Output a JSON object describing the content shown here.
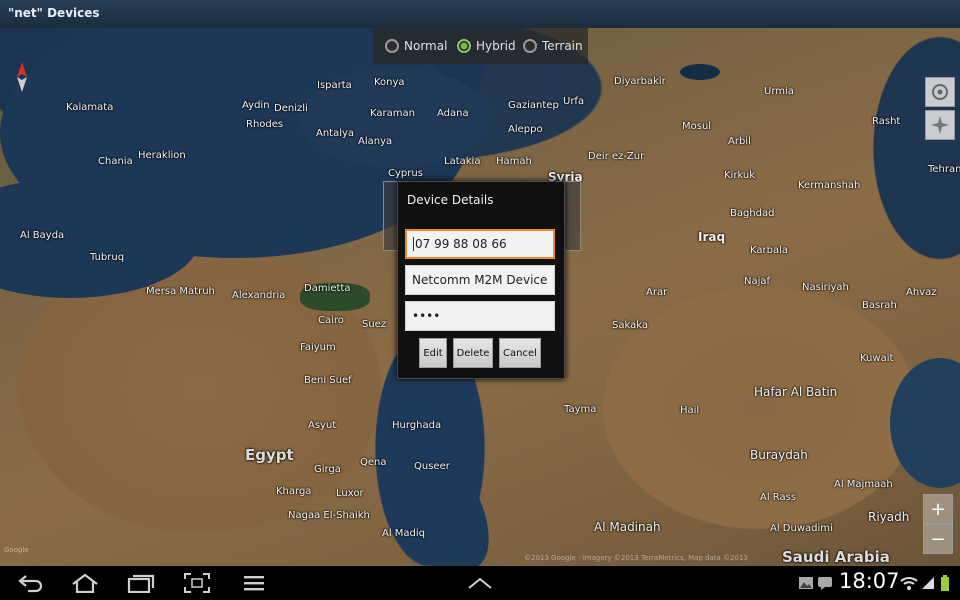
{
  "window": {
    "title": "\"net\" Devices"
  },
  "map_type": {
    "options": [
      {
        "label": "Normal",
        "selected": false
      },
      {
        "label": "Hybrid",
        "selected": true
      },
      {
        "label": "Terrain",
        "selected": false
      }
    ]
  },
  "map": {
    "labels": {
      "konya": "Konya",
      "isparta": "Isparta",
      "aydin": "Aydin",
      "denizli": "Denizli",
      "kalamata": "Kalamata",
      "rhodes": "Rhodes",
      "antalya": "Antalya",
      "alanya": "Alanya",
      "karaman": "Karaman",
      "adana": "Adana",
      "gaziantep": "Gaziantep",
      "urfa": "Urfa",
      "diyarbakir": "Diyarbakir",
      "aleppo": "Aleppo",
      "cyprus": "Cyprus",
      "latakia": "Latakia",
      "hamah": "Hamah",
      "syria": "Syria",
      "deir_ez_zur": "Deir ez-Zur",
      "mosul": "Mosul",
      "arbil": "Arbil",
      "kirkuk": "Kirkuk",
      "urmia": "Urmia",
      "rasht": "Rasht",
      "tehran": "Tehran",
      "kermanshah": "Kermanshah",
      "baghdad": "Baghdad",
      "iraq": "Iraq",
      "karbala": "Karbala",
      "najaf": "Najaf",
      "nasiriyah": "Nasiriyah",
      "basrah": "Basrah",
      "ahvaz": "Ahvaz",
      "kuwait": "Kuwait",
      "heraklion": "Heraklion",
      "chania": "Chania",
      "al_bayda": "Al Bayda",
      "tubruq": "Tubruq",
      "mersa_matruh": "Mersa Matruh",
      "alexandria": "Alexandria",
      "damietta": "Damietta",
      "cairo": "Cairo",
      "suez": "Suez",
      "faiyum": "Faiyum",
      "beni_suef": "Beni Suef",
      "asyut": "Asyut",
      "hurghada": "Hurghada",
      "egypt": "Egypt",
      "qena": "Qena",
      "quseer": "Quseer",
      "girga": "Girga",
      "kharga": "Kharga",
      "luxor": "Luxor",
      "nagaa_el_shaikh": "Nagaa El-Shaikh",
      "al_madiq": "Al Madiq",
      "tayma": "Tayma",
      "hail": "Hail",
      "sakaka": "Sakaka",
      "arar": "Arar",
      "hafar_al_batin": "Hafar Al Batin",
      "buraydah": "Buraydah",
      "al_rass": "Al Rass",
      "al_majmaah": "Al Majmaah",
      "al_madinah": "Al Madinah",
      "al_duwadimi": "Al Duwadimi",
      "riyadh": "Riyadh",
      "saudi_arabia": "Saudi Arabia"
    },
    "attribution": "©2013 Google - Imagery ©2013 TerraMetrics, Map data ©2013",
    "google_logo": "Google"
  },
  "dialog": {
    "title": "Device Details",
    "phone_value": "07 99 88 08 66",
    "name_value": "Netcomm M2M Device",
    "password_value": "••••",
    "edit_label": "Edit",
    "delete_label": "Delete",
    "cancel_label": "Cancel"
  },
  "zoom": {
    "in": "+",
    "out": "−"
  },
  "status": {
    "time": "18:07"
  },
  "colors": {
    "accent": "#f08a2c",
    "radio_on": "#6ec03c"
  }
}
